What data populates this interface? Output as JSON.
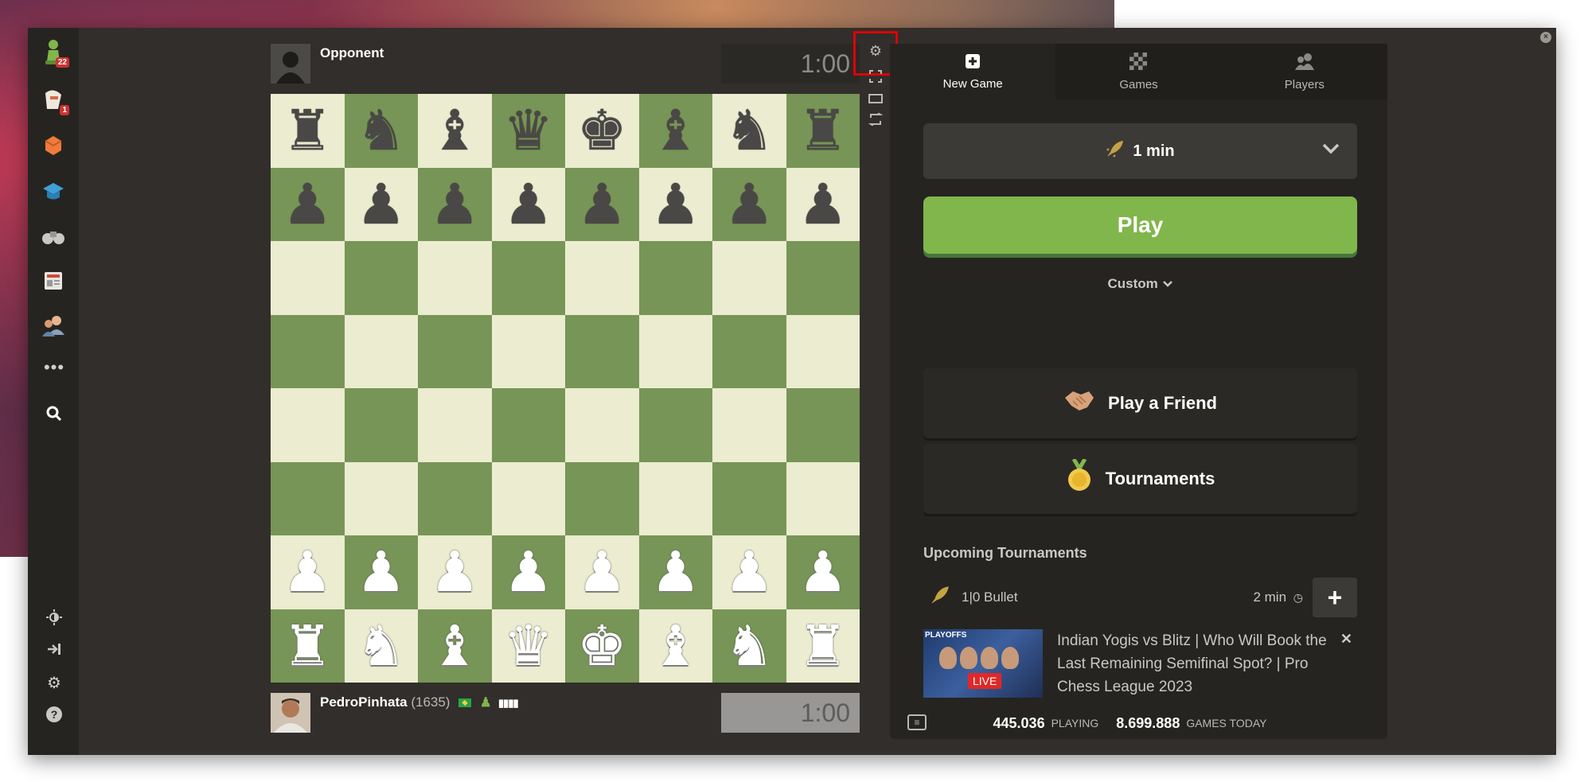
{
  "sidebar": {
    "play_badge": "22",
    "puzzles_badge": "1"
  },
  "top_player": {
    "name": "Opponent",
    "clock": "1:00"
  },
  "bottom_player": {
    "name": "PedroPinhata",
    "rating": "(1635)",
    "clock": "1:00"
  },
  "board": {
    "rows": [
      [
        "♜",
        "♞",
        "♝",
        "♛",
        "♚",
        "♝",
        "♞",
        "♜"
      ],
      [
        "♟",
        "♟",
        "♟",
        "♟",
        "♟",
        "♟",
        "♟",
        "♟"
      ],
      [
        "",
        "",
        "",
        "",
        "",
        "",
        "",
        ""
      ],
      [
        "",
        "",
        "",
        "",
        "",
        "",
        "",
        ""
      ],
      [
        "",
        "",
        "",
        "",
        "",
        "",
        "",
        ""
      ],
      [
        "",
        "",
        "",
        "",
        "",
        "",
        "",
        ""
      ],
      [
        "♟",
        "♟",
        "♟",
        "♟",
        "♟",
        "♟",
        "♟",
        "♟"
      ],
      [
        "♜",
        "♞",
        "♝",
        "♛",
        "♚",
        "♝",
        "♞",
        "♜"
      ]
    ],
    "light_color": "#ebecd0",
    "dark_color": "#779556"
  },
  "panel": {
    "tabs": [
      {
        "label": "New Game",
        "active": true
      },
      {
        "label": "Games",
        "active": false
      },
      {
        "label": "Players",
        "active": false
      }
    ],
    "time_control": "1 min",
    "play_label": "Play",
    "custom_label": "Custom",
    "play_friend_label": "Play a Friend",
    "tournaments_label": "Tournaments",
    "upcoming_title": "Upcoming Tournaments",
    "tournament": {
      "name": "1|0 Bullet",
      "time": "2 min"
    },
    "news": {
      "thumb_label": "PLAYOFFS",
      "live_label": "LIVE",
      "title": "Indian Yogis vs Blitz | Who Will Book the Last Remaining Semifinal Spot? | Pro Chess League 2023"
    },
    "stats": {
      "playing_count": "445.036",
      "playing_label": "PLAYING",
      "games_count": "8.699.888",
      "games_label": "GAMES TODAY"
    }
  },
  "colors": {
    "play_button": "#81b64c",
    "background": "#312e2b",
    "highlight": "#e00000"
  }
}
